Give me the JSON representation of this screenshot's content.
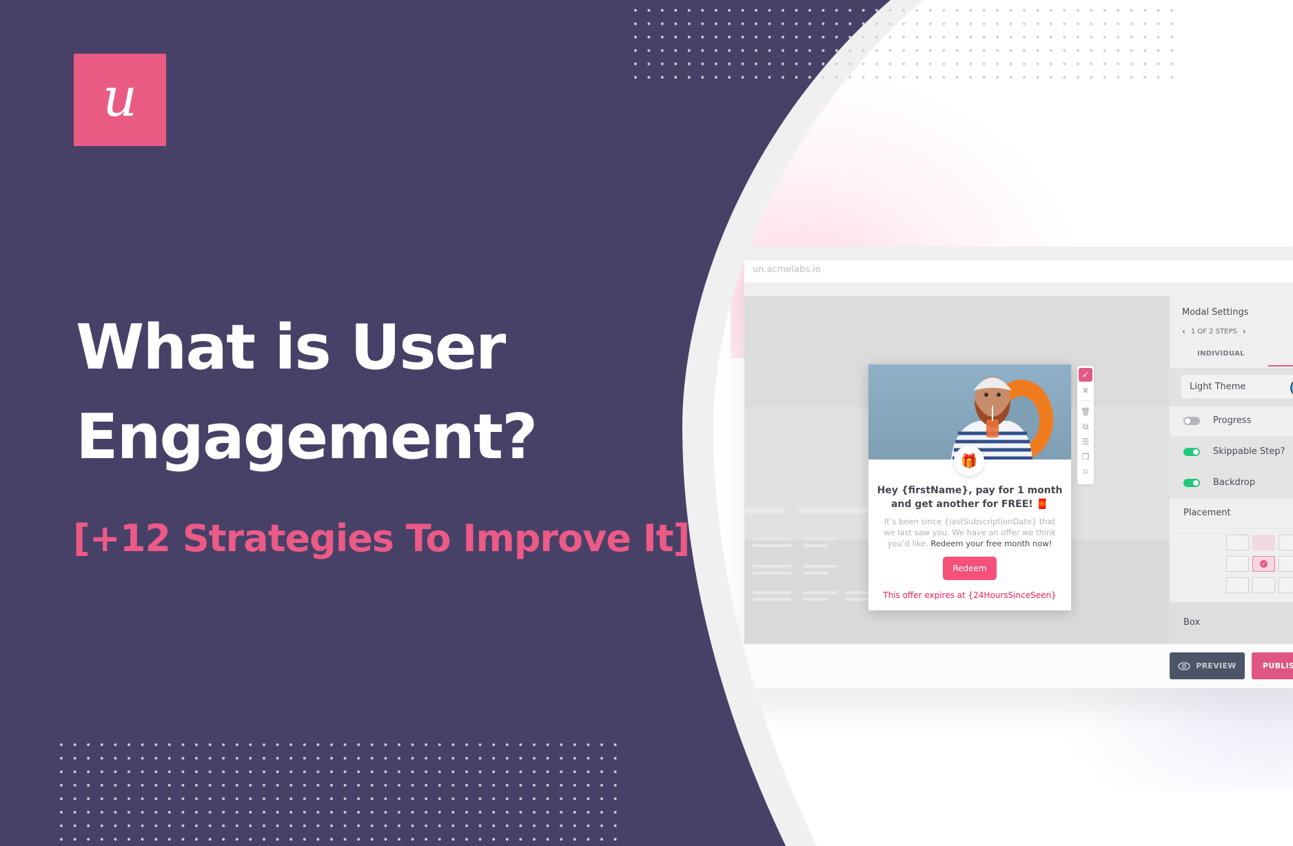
{
  "brand": {
    "logo_glyph": "u",
    "colors": {
      "purple": "#474168",
      "pink": "#ea5b84",
      "white": "#ffffff"
    }
  },
  "hero": {
    "headline_line1": "What is User",
    "headline_line2": "Engagement?",
    "subheadline": "[+12 Strategies To Improve It]"
  },
  "app": {
    "url": "un.acmelabs.io",
    "settings": {
      "title": "Modal Settings",
      "steps_label": "1 OF 2 STEPS",
      "prev_icon": "‹",
      "next_icon": "›",
      "tab_individual": "INDIVIDUAL",
      "theme": "Light Theme",
      "toggles": [
        {
          "label": "Progress",
          "on": false
        },
        {
          "label": "Skippable Step?",
          "on": true
        },
        {
          "label": "Backdrop",
          "on": true
        }
      ],
      "placement_label": "Placement",
      "placement_selected": "middle-center",
      "box_label": "Box"
    },
    "footer": {
      "preview_label": "PREVIEW",
      "publish_label": "PUBLIS"
    },
    "modal": {
      "title_line1": "Hey {firstName}, pay for 1 month",
      "title_line2": "and get another for FREE! 🧧",
      "body_muted": "It’s been since {lastSubscriptionDate} that we last saw you. We have an offer we think you’d like. ",
      "body_strong": "Redeem your free month now!",
      "button_label": "Redeem",
      "expiry": "This offer expires at {24HoursSinceSeen}",
      "badge_icon": "🎁"
    },
    "toolbar": {
      "confirm": "✓",
      "close": "✕",
      "delete": "🗑",
      "duplicate": "⧉",
      "settings": "☰",
      "copy-style": "❐",
      "bookmark": "⌑"
    }
  }
}
